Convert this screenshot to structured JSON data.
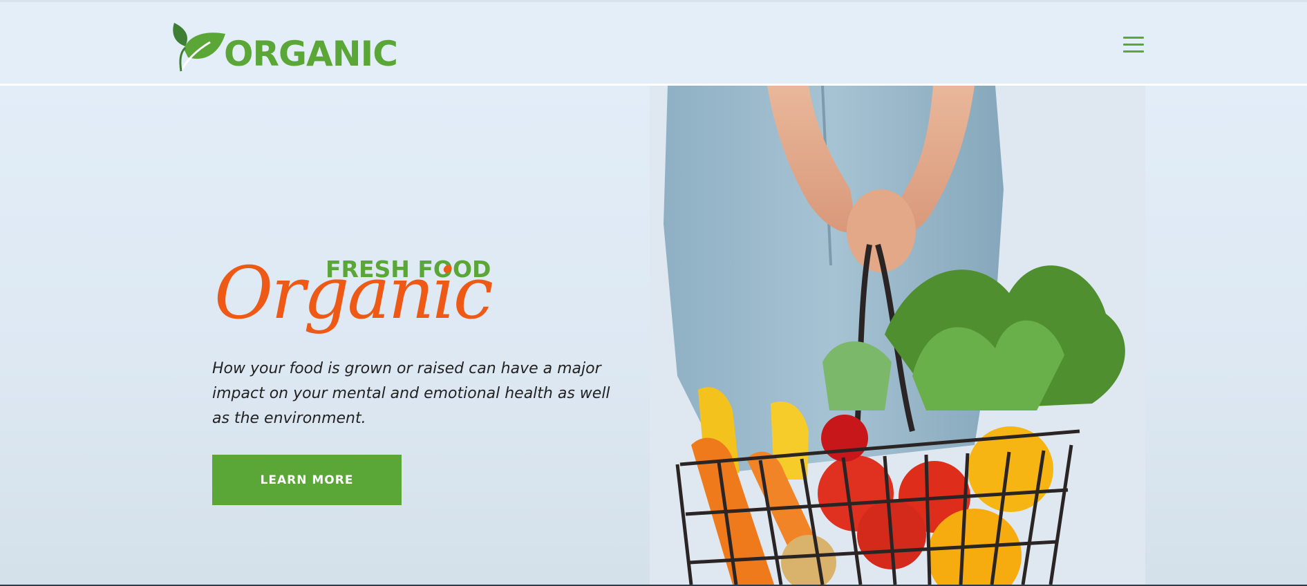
{
  "brand": {
    "name": "ORGANIC",
    "logo_icon": "leaf-icon"
  },
  "header": {
    "menu_icon": "hamburger-menu-icon"
  },
  "hero": {
    "kicker": "FRESH FOOD",
    "script_title": "Organic",
    "description": "How your food is grown or raised can have a major impact on your mental and emotional health as well as the environment.",
    "cta_label": "LEARN MORE",
    "image_subject": "person-holding-vegetable-basket"
  },
  "colors": {
    "brand_green": "#5aa637",
    "accent_orange": "#ee5a16",
    "background": "#e3eef9",
    "text_dark": "#222222"
  }
}
